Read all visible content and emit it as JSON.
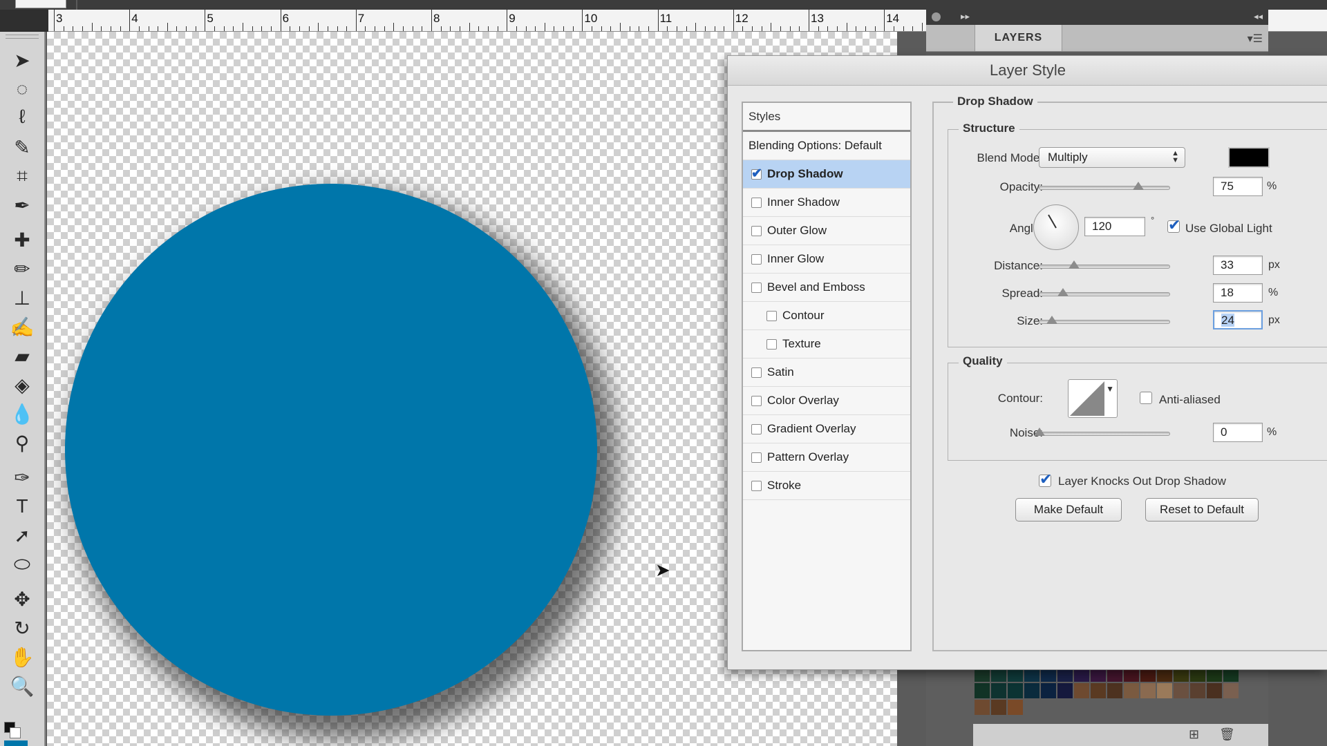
{
  "ruler": {
    "labels": [
      "3",
      "4",
      "5",
      "6",
      "7",
      "8",
      "9",
      "10",
      "11",
      "12",
      "13",
      "14"
    ]
  },
  "canvas": {
    "shape_color": "#0076aa"
  },
  "layers_panel": {
    "tab_label": "LAYERS"
  },
  "dialog": {
    "title": "Layer Style",
    "styles_header": "Styles",
    "blending_options": "Blending Options: Default",
    "effects": [
      {
        "label": "Drop Shadow",
        "checked": true,
        "selected": true,
        "indent": 1
      },
      {
        "label": "Inner Shadow",
        "checked": false,
        "indent": 1
      },
      {
        "label": "Outer Glow",
        "checked": false,
        "indent": 1
      },
      {
        "label": "Inner Glow",
        "checked": false,
        "indent": 1
      },
      {
        "label": "Bevel and Emboss",
        "checked": false,
        "indent": 1
      },
      {
        "label": "Contour",
        "checked": false,
        "indent": 2
      },
      {
        "label": "Texture",
        "checked": false,
        "indent": 2
      },
      {
        "label": "Satin",
        "checked": false,
        "indent": 1
      },
      {
        "label": "Color Overlay",
        "checked": false,
        "indent": 1
      },
      {
        "label": "Gradient Overlay",
        "checked": false,
        "indent": 1
      },
      {
        "label": "Pattern Overlay",
        "checked": false,
        "indent": 1
      },
      {
        "label": "Stroke",
        "checked": false,
        "indent": 1
      }
    ],
    "drop_shadow": {
      "title": "Drop Shadow",
      "structure_title": "Structure",
      "blend_mode_label": "Blend Mode:",
      "blend_mode_value": "Multiply",
      "shadow_color": "#000000",
      "opacity_label": "Opacity:",
      "opacity_value": "75",
      "opacity_unit": "%",
      "angle_label": "Angle:",
      "angle_value": "120",
      "angle_unit": "°",
      "use_global_light_label": "Use Global Light",
      "use_global_light_checked": true,
      "distance_label": "Distance:",
      "distance_value": "33",
      "distance_unit": "px",
      "spread_label": "Spread:",
      "spread_value": "18",
      "spread_unit": "%",
      "size_label": "Size:",
      "size_value": "24",
      "size_unit": "px",
      "quality_title": "Quality",
      "contour_label": "Contour:",
      "anti_aliased_label": "Anti-aliased",
      "anti_aliased_checked": false,
      "noise_label": "Noise:",
      "noise_value": "0",
      "noise_unit": "%",
      "knockout_label": "Layer Knocks Out Drop Shadow",
      "knockout_checked": true,
      "make_default_label": "Make Default",
      "reset_default_label": "Reset to Default"
    }
  },
  "icons": [
    "move-tool-icon",
    "elliptical-marquee-icon",
    "lasso-icon",
    "quick-selection-icon",
    "crop-icon",
    "eyedropper-icon",
    "healing-brush-icon",
    "brush-icon",
    "clone-stamp-icon",
    "history-brush-icon",
    "eraser-icon",
    "paint-bucket-icon",
    "blur-icon",
    "dodge-icon",
    "pen-icon",
    "type-icon",
    "path-selection-icon",
    "ellipse-shape-icon",
    "3d-rotate-icon",
    "3d-orbit-icon",
    "hand-icon",
    "zoom-icon"
  ]
}
